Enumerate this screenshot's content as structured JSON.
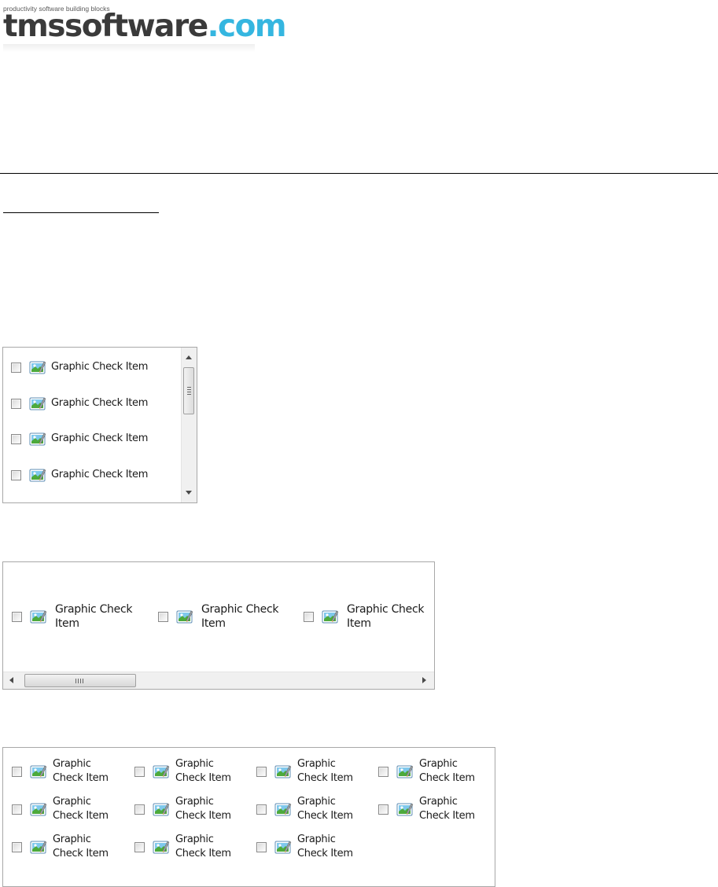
{
  "header": {
    "tagline": "productivity software building blocks",
    "logo_text_dark": "tmssoftware",
    "logo_text_accent": ".com",
    "colors": {
      "logo_dark": "#3a3a3a",
      "logo_accent": "#35b6e0"
    }
  },
  "vertical_list": {
    "items": [
      {
        "label": "Graphic Check Item",
        "checked": false,
        "icon": "picture-icon"
      },
      {
        "label": "Graphic Check Item",
        "checked": false,
        "icon": "picture-icon"
      },
      {
        "label": "Graphic Check Item",
        "checked": false,
        "icon": "picture-icon"
      },
      {
        "label": "Graphic Check Item",
        "checked": false,
        "icon": "picture-icon"
      }
    ]
  },
  "horizontal_list": {
    "items": [
      {
        "label": "Graphic Check Item",
        "checked": false,
        "icon": "picture-icon"
      },
      {
        "label": "Graphic Check Item",
        "checked": false,
        "icon": "picture-icon"
      },
      {
        "label": "Graphic Check Item",
        "checked": false,
        "icon": "picture-icon"
      }
    ]
  },
  "grid_list": {
    "columns": 4,
    "items": [
      {
        "label": "Graphic Check Item",
        "checked": false,
        "icon": "picture-icon"
      },
      {
        "label": "Graphic Check Item",
        "checked": false,
        "icon": "picture-icon"
      },
      {
        "label": "Graphic Check Item",
        "checked": false,
        "icon": "picture-icon"
      },
      {
        "label": "Graphic Check Item",
        "checked": false,
        "icon": "picture-icon"
      },
      {
        "label": "Graphic Check Item",
        "checked": false,
        "icon": "picture-icon"
      },
      {
        "label": "Graphic Check Item",
        "checked": false,
        "icon": "picture-icon"
      },
      {
        "label": "Graphic Check Item",
        "checked": false,
        "icon": "picture-icon"
      },
      {
        "label": "Graphic Check Item",
        "checked": false,
        "icon": "picture-icon"
      },
      {
        "label": "Graphic Check Item",
        "checked": false,
        "icon": "picture-icon"
      },
      {
        "label": "Graphic Check Item",
        "checked": false,
        "icon": "picture-icon"
      },
      {
        "label": "Graphic Check Item",
        "checked": false,
        "icon": "picture-icon"
      }
    ]
  }
}
